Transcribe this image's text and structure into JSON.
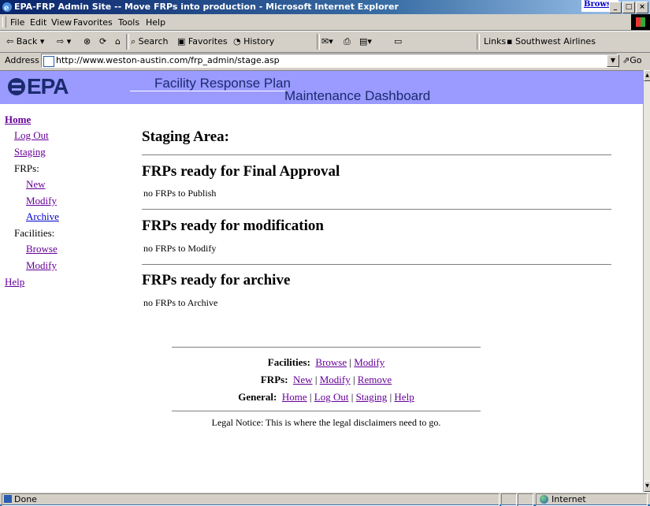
{
  "window": {
    "title": "EPA-FRP Admin Site -- Move FRPs into production - Microsoft Internet Explorer",
    "peek_link": "Browse",
    "buttons": [
      "_",
      "□",
      "×"
    ]
  },
  "menu": [
    "File",
    "Edit",
    "View",
    "Favorites",
    "Tools",
    "Help"
  ],
  "toolbar": {
    "back": "Back",
    "search": "Search",
    "favorites": "Favorites",
    "history": "History",
    "links_label": "Links",
    "links_item": "Southwest Airlines"
  },
  "address": {
    "label": "Address",
    "url": "http://www.weston-austin.com/frp_admin/stage.asp",
    "go": "Go"
  },
  "banner": {
    "logo": "EPA",
    "title_line1": "Facility Response Plan",
    "title_line2": "Maintenance Dashboard"
  },
  "sidebar": {
    "home": "Home",
    "logout": "Log Out",
    "staging": "Staging",
    "frps_label": "FRPs:",
    "frp_new": "New",
    "frp_modify": "Modify",
    "frp_archive": "Archive",
    "facilities_label": "Facilities:",
    "fac_browse": "Browse",
    "fac_modify": "Modify",
    "help": "Help"
  },
  "main": {
    "heading": "Staging Area:",
    "sections": [
      {
        "title": "FRPs ready for Final Approval",
        "text": "no FRPs to Publish"
      },
      {
        "title": "FRPs ready for modification",
        "text": "no FRPs to Modify"
      },
      {
        "title": "FRPs ready for archive",
        "text": "no FRPs to Archive"
      }
    ]
  },
  "footer": {
    "facilities_label": "Facilities:",
    "facilities_links": [
      "Browse",
      "Modify"
    ],
    "frps_label": "FRPs:",
    "frps_links": [
      "New",
      "Modify",
      "Remove"
    ],
    "general_label": "General:",
    "general_links": [
      "Home",
      "Log Out",
      "Staging",
      "Help"
    ],
    "separator": "|",
    "legal": "Legal Notice: This is where the legal disclaimers need to go."
  },
  "status": {
    "text": "Done",
    "zone": "Internet"
  }
}
